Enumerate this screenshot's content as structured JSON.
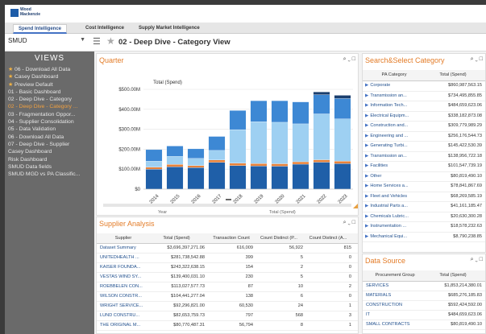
{
  "brand": {
    "name": "Wood Mackenzie"
  },
  "tabs": [
    {
      "label": "Spend Intelligence",
      "active": true
    },
    {
      "label": "Cost Intelligence"
    },
    {
      "label": "Supply Market Intelligence"
    }
  ],
  "topbar": {
    "org": "SMUD",
    "page_title": "02 - Deep Dive - Category View"
  },
  "sidebar": {
    "heading": "VIEWS",
    "items": [
      {
        "label": "06 - Download All Data",
        "star": true
      },
      {
        "label": "Casey Dashboard",
        "star": true
      },
      {
        "label": "Preview Default",
        "star": true
      },
      {
        "label": "01 - Basic Dashboard"
      },
      {
        "label": "02 - Deep Dive - Category"
      },
      {
        "label": "02 - Deep Dive - Category ...",
        "active": true
      },
      {
        "label": "03 - Fragmentation Oppor..."
      },
      {
        "label": "04 - Supplier Consolidation"
      },
      {
        "label": "05 - Data Validation"
      },
      {
        "label": "06 - Download All Data"
      },
      {
        "label": "07 - Deep Dive - Supplier"
      },
      {
        "label": "Casey Dashboard"
      },
      {
        "label": "Risk Dashboard"
      },
      {
        "label": "SMUD Data fields"
      },
      {
        "label": "SMUD MGD vs PA Classific..."
      }
    ]
  },
  "quarter": {
    "title": "Quarter",
    "icons": "⌕ ⌄ □",
    "legend_title": "Total (Spend)",
    "footer_left": "Year",
    "footer_right": "Total (Spend)"
  },
  "chart_data": {
    "type": "bar",
    "stacked": true,
    "title": "",
    "ylabel": "Total (Spend)",
    "categories": [
      "2014",
      "2015",
      "2016",
      "2017",
      "2018",
      "2019",
      "2020",
      "2021",
      "2022",
      "2023"
    ],
    "yticks": [
      "$0",
      "$100.00M",
      "$200.00M",
      "$300.00M",
      "$400.00M",
      "$500.00M"
    ],
    "ylim": [
      0,
      500
    ],
    "series": [
      {
        "values": [
          100,
          112,
          108,
          134,
          118,
          116,
          115,
          125,
          135,
          128
        ],
        "color": "#1f5fa8"
      },
      {
        "values": [
          10,
          12,
          10,
          12,
          12,
          12,
          12,
          12,
          12,
          12
        ],
        "color": "#e8823a"
      },
      {
        "values": [
          30,
          40,
          36,
          48,
          168,
          210,
          208,
          190,
          230,
          212
        ],
        "color": "#9ed0f2"
      },
      {
        "values": [
          58,
          52,
          48,
          70,
          96,
          105,
          108,
          110,
          96,
          102
        ],
        "color": "#3d88d4"
      },
      {
        "values": [
          0,
          0,
          0,
          0,
          0,
          0,
          0,
          0,
          14,
          16
        ],
        "color": "#1b3f6e"
      }
    ]
  },
  "supplier": {
    "title": "Supplier Analysis",
    "icons": "⌕ ⌄ □",
    "columns": [
      "Supplier",
      "Total (Spend)",
      "Transaction Count",
      "Count Distinct (P...",
      "Count Distinct (A..."
    ],
    "rows": [
      [
        "Dataset Summary",
        "$3,696,397,271.06",
        "616,009",
        "56,922",
        "815"
      ],
      [
        "UNITEDHEALTH ...",
        "$281,738,542.88",
        "399",
        "5",
        "0"
      ],
      [
        "KAISER FOUNDA...",
        "$243,322,638.15",
        "154",
        "2",
        "0"
      ],
      [
        "VESTAS WIND SY...",
        "$139,400,031.10",
        "230",
        "5",
        "0"
      ],
      [
        "ROEBBELEN CON...",
        "$113,027,577.73",
        "87",
        "10",
        "2"
      ],
      [
        "WILSON CONSTR...",
        "$104,441,277.04",
        "138",
        "6",
        "0"
      ],
      [
        "WRIGHT SERVICE...",
        "$92,296,821.00",
        "60,530",
        "24",
        "1"
      ],
      [
        "LUND CONSTRU...",
        "$82,653,759.73",
        "797",
        "568",
        "3"
      ],
      [
        "THE ORIGINAL M...",
        "$80,770,487.31",
        "56,794",
        "8",
        "1"
      ]
    ]
  },
  "search": {
    "title": "Search&Select Category",
    "icons": "⌕ ⌄ □",
    "columns": [
      "PA Category",
      "Total (Spend)"
    ],
    "rows": [
      [
        "Corporate",
        "$860,987,563.15"
      ],
      [
        "Transmission an...",
        "$734,495,855.85"
      ],
      [
        "Information Tech...",
        "$484,659,623.06"
      ],
      [
        "Electrical Equipm...",
        "$338,182,873.08"
      ],
      [
        "Construction and...",
        "$309,779,989.29"
      ],
      [
        "Engineering and ...",
        "$256,176,544.73"
      ],
      [
        "Generating Turbi...",
        "$145,422,530.39"
      ],
      [
        "Transmission an...",
        "$138,956,722.18"
      ],
      [
        "Facilities",
        "$101,547,739.19"
      ],
      [
        "Other",
        "$80,819,490.10"
      ],
      [
        "Home Services a...",
        "$78,841,867.69"
      ],
      [
        "Fleet and Vehicles",
        "$68,269,585.19"
      ],
      [
        "Industrial Parts a...",
        "$41,161,185.47"
      ],
      [
        "Chemicals Lubric...",
        "$20,630,300.28"
      ],
      [
        "Instrumentation ...",
        "$18,578,232.63"
      ],
      [
        "Mechanical Equi...",
        "$8,790,238.85"
      ]
    ]
  },
  "datasource": {
    "title": "Data Source",
    "icons": "⌕ ⌄ □",
    "columns": [
      "Procurement Group",
      "Total (Spend)"
    ],
    "rows": [
      [
        "SERVICES",
        "$1,853,214,380.01"
      ],
      [
        "MATERIALS",
        "$685,276,185.83"
      ],
      [
        "CONSTRUCTION",
        "$592,424,592.00"
      ],
      [
        "IT",
        "$484,659,623.06"
      ],
      [
        "SMALL CONTRACTS",
        "$80,819,490.10"
      ]
    ]
  }
}
